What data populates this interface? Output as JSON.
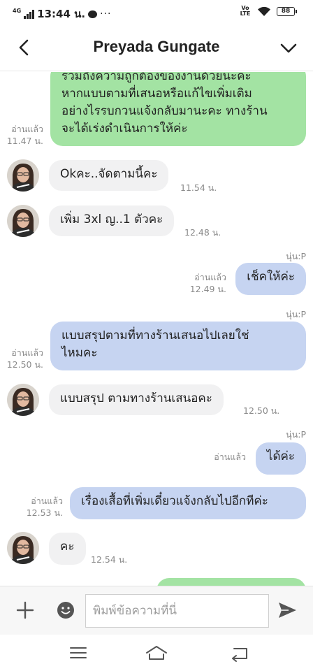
{
  "status_bar": {
    "network": "4G",
    "time": "13:44 น.",
    "dots": "···",
    "volte": "Vo LTE",
    "battery": "88"
  },
  "header": {
    "title": "Preyada Gungate"
  },
  "messages": [
    {
      "side": "right",
      "lines": [
        "รวมถึงความถูกต้องของงานด้วยนะคะ",
        "หากแบบตามที่เสนอหรือแก้ไขเพิ่มเติม",
        "อย่างไรรบกวนแจ้งกลับมานะคะ ทางร้าน",
        "จะได้เร่งดำเนินการให้ค่ะ"
      ],
      "read": "อ่านแล้ว",
      "time": "11.47 น."
    },
    {
      "side": "left",
      "text": "Okคะ..จัดตามนี้คะ",
      "time": "11.54 น."
    },
    {
      "side": "left",
      "text": "เพิ่ม 3xl ญ..1 ตัวคะ",
      "time": "12.48 น."
    },
    {
      "side": "right",
      "sender": "นุ่น:P",
      "text": "เช็คให้ค่ะ",
      "read": "อ่านแล้ว",
      "time": "12.49 น."
    },
    {
      "side": "right",
      "sender": "นุ่น:P",
      "lines": [
        "แบบสรุปตามที่ทางร้านเสนอไปเลยใช่",
        "ไหมคะ"
      ],
      "read": "อ่านแล้ว",
      "time": "12.50 น."
    },
    {
      "side": "left",
      "text": "แบบสรุป ตามทางร้านเสนอคะ",
      "time": "12.50 น."
    },
    {
      "side": "right",
      "sender": "นุ่น:P",
      "text": "ได้ค่ะ",
      "read": "อ่านแล้ว"
    },
    {
      "side": "right",
      "text": "เรื่องเสื้อที่เพิ่มเดี๋ยวแจ้งกลับไปอีกทีค่ะ",
      "read": "อ่านแล้ว",
      "time": "12.53 น."
    },
    {
      "side": "left",
      "text": "คะ",
      "time": "12.54 น."
    }
  ],
  "input_bar": {
    "placeholder": "พิมพ์ข้อความที่นี่"
  },
  "colors": {
    "outgoing_green": "#a3e3a3",
    "outgoing_blue": "#c6d4f1",
    "incoming_grey": "#f1f1f2",
    "meta_grey": "#8a8a8a"
  },
  "icons": [
    "back-chevron-icon",
    "chevron-down-icon",
    "plus-icon",
    "emoji-icon",
    "send-icon",
    "menu-icon",
    "home-icon",
    "return-icon"
  ]
}
